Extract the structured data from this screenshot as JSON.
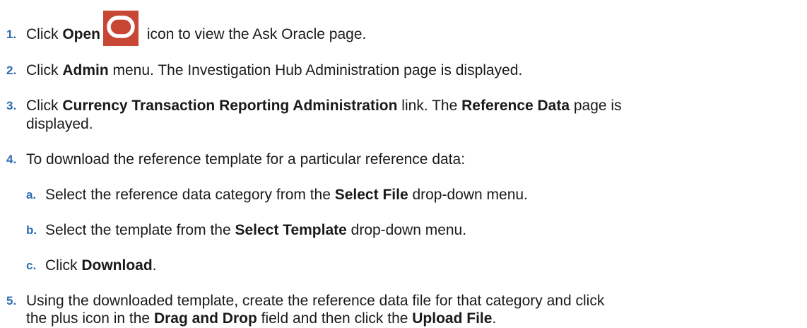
{
  "steps": [
    {
      "number": "1.",
      "pre": "Click ",
      "bold": "Open",
      "icon": "oracle-open-icon",
      "post": " icon to view the Ask Oracle page."
    },
    {
      "number": "2.",
      "pre": "Click ",
      "bold": "Admin",
      "post": " menu. The Investigation Hub Administration page is displayed."
    },
    {
      "number": "3.",
      "pre": "Click ",
      "bold": "Currency Transaction Reporting Administration",
      "mid": " link. The ",
      "bold2": "Reference Data",
      "post": " page is",
      "line2": "displayed."
    },
    {
      "number": "4.",
      "text": "To download the reference template for a particular reference data:",
      "substeps": [
        {
          "letter": "a.",
          "pre": "Select the reference data category from the ",
          "bold": "Select File",
          "post": " drop-down menu."
        },
        {
          "letter": "b.",
          "pre": "Select the template from the ",
          "bold": "Select Template",
          "post": " drop-down menu."
        },
        {
          "letter": "c.",
          "pre": "Click ",
          "bold": "Download",
          "post": "."
        }
      ]
    },
    {
      "number": "5.",
      "line1": "Using the downloaded template, create the reference data file for that category and click",
      "pre": "the plus icon in the ",
      "bold": "Drag and Drop",
      "mid": " field and then click the ",
      "bold2": "Upload File",
      "post": "."
    }
  ],
  "colors": {
    "number": "#2d6bb0",
    "icon_bg": "#c74634",
    "text": "#1a1a1a"
  }
}
